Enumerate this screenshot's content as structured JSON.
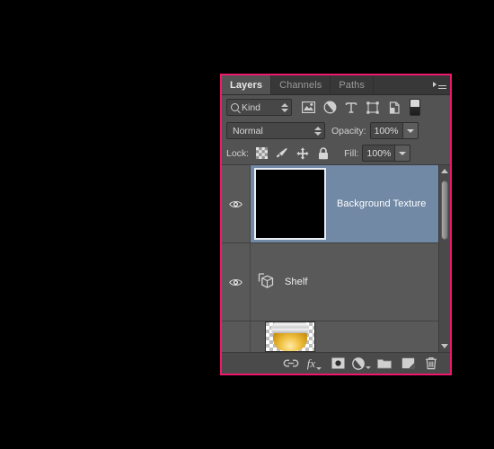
{
  "panel": {
    "accent_border_color": "#f0186e",
    "background_color": "#535353",
    "selected_row_color": "#7189a5"
  },
  "tabs": [
    {
      "label": "Layers",
      "active": true,
      "name": "tab-layers"
    },
    {
      "label": "Channels",
      "active": false,
      "name": "tab-channels"
    },
    {
      "label": "Paths",
      "active": false,
      "name": "tab-paths"
    }
  ],
  "panel_menu": {
    "icon": "panel-menu-icon"
  },
  "filter": {
    "kind_label": "Kind",
    "search_icon": "magnifier-icon",
    "stepper_icon": "up-down-arrows-icon",
    "icons": [
      {
        "name": "filter-pixel-layers-icon",
        "title": "Pixel Layers"
      },
      {
        "name": "filter-adjustment-layers-icon",
        "title": "Adjustment Layers"
      },
      {
        "name": "filter-type-layers-icon",
        "title": "Type Layers"
      },
      {
        "name": "filter-shape-layers-icon",
        "title": "Shape Layers"
      },
      {
        "name": "filter-smart-objects-icon",
        "title": "Smart Objects"
      }
    ],
    "toggle": {
      "name": "filter-enable-toggle",
      "state": "off"
    }
  },
  "blend": {
    "mode": "Normal",
    "opacity_label": "Opacity:",
    "opacity_value": "100%"
  },
  "lock": {
    "label": "Lock:",
    "buttons": [
      {
        "name": "lock-transparent-pixels-icon",
        "title": "Lock transparent pixels"
      },
      {
        "name": "lock-image-pixels-icon",
        "title": "Lock image pixels"
      },
      {
        "name": "lock-position-icon",
        "title": "Lock position"
      },
      {
        "name": "lock-all-icon",
        "title": "Lock all"
      }
    ],
    "fill_label": "Fill:",
    "fill_value": "100%"
  },
  "layers": [
    {
      "name": "Background Texture",
      "selected": true,
      "visible": true,
      "thumb_type": "solid-black",
      "has_icon": false
    },
    {
      "name": "Shelf",
      "selected": false,
      "visible": true,
      "thumb_type": "none",
      "has_icon": true,
      "icon_name": "3d-layer-icon"
    },
    {
      "name": "",
      "selected": false,
      "visible": false,
      "thumb_type": "honey-jar",
      "has_icon": false
    }
  ],
  "scrollbar": {
    "up_arrow": "scroll-up-arrow-icon",
    "down_arrow": "scroll-down-arrow-icon"
  },
  "bottom_toolbar": [
    {
      "name": "link-layers-button",
      "icon": "link-icon",
      "label": ""
    },
    {
      "name": "layer-style-button",
      "icon": "fx-icon",
      "label": "fx"
    },
    {
      "name": "add-layer-mask-button",
      "icon": "layer-mask-icon",
      "label": ""
    },
    {
      "name": "new-adjustment-layer-button",
      "icon": "adjustment-icon",
      "label": ""
    },
    {
      "name": "new-group-button",
      "icon": "folder-icon",
      "label": ""
    },
    {
      "name": "new-layer-button",
      "icon": "new-layer-icon",
      "label": ""
    },
    {
      "name": "delete-layer-button",
      "icon": "trash-icon",
      "label": ""
    }
  ]
}
